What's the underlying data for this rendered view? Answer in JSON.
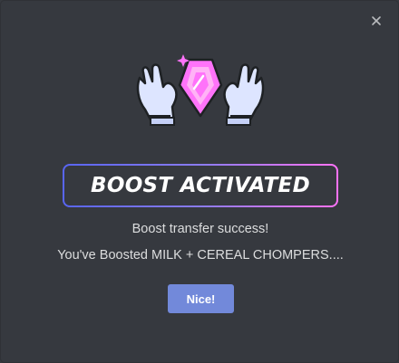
{
  "dialog": {
    "close_icon": "close-icon",
    "illustration_icon": "boost-gem-hands-icon",
    "banner_title": "BOOST ACTIVATED",
    "message_line1": "Boost transfer success!",
    "message_line2": "You've Boosted MILK + CEREAL CHOMPERS....",
    "confirm_label": "Nice!"
  },
  "colors": {
    "background": "#36393f",
    "accent_blue": "#5865f2",
    "accent_pink": "#ff73fa",
    "button": "#7289da",
    "text": "#dcddde"
  }
}
